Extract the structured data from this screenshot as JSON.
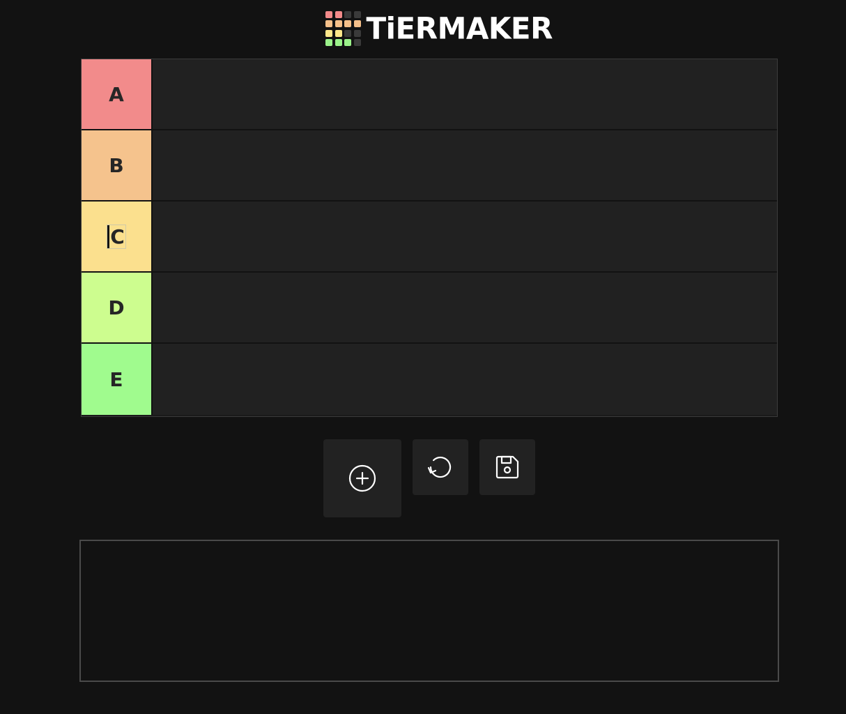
{
  "logo": {
    "wordmark": "TiERMAKER",
    "grid_colors": [
      "#f28a8a",
      "#f28a8a",
      "#3a3a3a",
      "#3a3a3a",
      "#f5c08a",
      "#f5c08a",
      "#f5c08a",
      "#f5c08a",
      "#fde68a",
      "#fde68a",
      "#3a3a3a",
      "#3a3a3a",
      "#9bf28a",
      "#9bf28a",
      "#9bf28a",
      "#3a3a3a"
    ]
  },
  "tiers": [
    {
      "label": "A",
      "color": "#f28b8b",
      "editing": false
    },
    {
      "label": "B",
      "color": "#f5c38d",
      "editing": false
    },
    {
      "label": "C",
      "color": "#fbe08e",
      "editing": true
    },
    {
      "label": "D",
      "color": "#cdfd8f",
      "editing": false
    },
    {
      "label": "E",
      "color": "#a0fb8e",
      "editing": false
    }
  ],
  "actions": {
    "add_icon": "plus-circle-icon",
    "reset_icon": "rotate-ccw-icon",
    "save_icon": "save-floppy-icon"
  }
}
